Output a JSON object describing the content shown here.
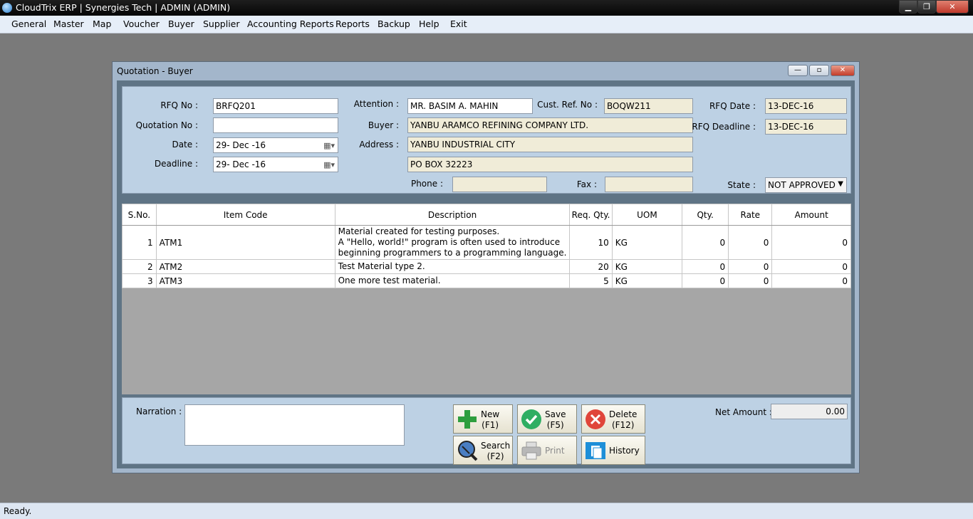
{
  "window": {
    "title": "CloudTrix ERP | Synergies Tech | ADMIN (ADMIN)",
    "min": "▁",
    "max": "❐",
    "close": "✕"
  },
  "menu": [
    "General",
    "Master",
    "Map",
    "Voucher",
    "Buyer",
    "Supplier",
    "Accounting Reports",
    "Reports",
    "Backup",
    "Help",
    "Exit"
  ],
  "dialog": {
    "title": "Quotation - Buyer",
    "min": "—",
    "max": "▫",
    "close": "✕"
  },
  "form": {
    "rfq_no_label": "RFQ No :",
    "rfq_no": "BRFQ201",
    "quotation_no_label": "Quotation No :",
    "quotation_no": "",
    "date_label": "Date :",
    "date": "29- Dec -16",
    "deadline_label": "Deadline :",
    "deadline": "29- Dec -16",
    "attention_label": "Attention :",
    "attention": "MR. BASIM A. MAHIN",
    "cust_ref_label": "Cust. Ref. No :",
    "cust_ref": "BOQW211",
    "buyer_label": "Buyer :",
    "buyer": "YANBU ARAMCO REFINING COMPANY LTD.",
    "address_label": "Address :",
    "address1": "YANBU INDUSTRIAL CITY",
    "address2": "PO BOX 32223",
    "phone_label": "Phone :",
    "phone": "",
    "fax_label": "Fax :",
    "fax": "",
    "rfq_date_label": "RFQ Date :",
    "rfq_date": "13-DEC-16",
    "rfq_deadline_label": "RFQ Deadline :",
    "rfq_deadline": "13-DEC-16",
    "state_label": "State :",
    "state": "NOT APPROVED",
    "calendar_glyph": "▦▾",
    "dropdown_glyph": "▼"
  },
  "grid": {
    "headers": [
      "S.No.",
      "Item Code",
      "Description",
      "Req. Qty.",
      "UOM",
      "Qty.",
      "Rate",
      "Amount"
    ],
    "rows": [
      {
        "sno": "1",
        "code": "ATM1",
        "desc": [
          "Material created for testing purposes.",
          "A \"Hello, world!\" program is often used to introduce",
          "beginning programmers to a programming language."
        ],
        "req": "10",
        "uom": "KG",
        "qty": "0",
        "rate": "0",
        "amount": "0"
      },
      {
        "sno": "2",
        "code": "ATM2",
        "desc": [
          "Test Material type 2."
        ],
        "req": "20",
        "uom": "KG",
        "qty": "0",
        "rate": "0",
        "amount": "0"
      },
      {
        "sno": "3",
        "code": "ATM3",
        "desc": [
          "One more test material."
        ],
        "req": "5",
        "uom": "KG",
        "qty": "0",
        "rate": "0",
        "amount": "0"
      }
    ]
  },
  "footer": {
    "narration_label": "Narration :",
    "narration": "",
    "net_amount_label": "Net Amount :",
    "net_amount": "0.00",
    "new_label": "New",
    "new_key": "(F1)",
    "save_label": "Save",
    "save_key": "(F5)",
    "delete_label": "Delete",
    "delete_key": "(F12)",
    "search_label": "Search",
    "search_key": "(F2)",
    "print_label": "Print",
    "history_label": "History"
  },
  "status": "Ready."
}
